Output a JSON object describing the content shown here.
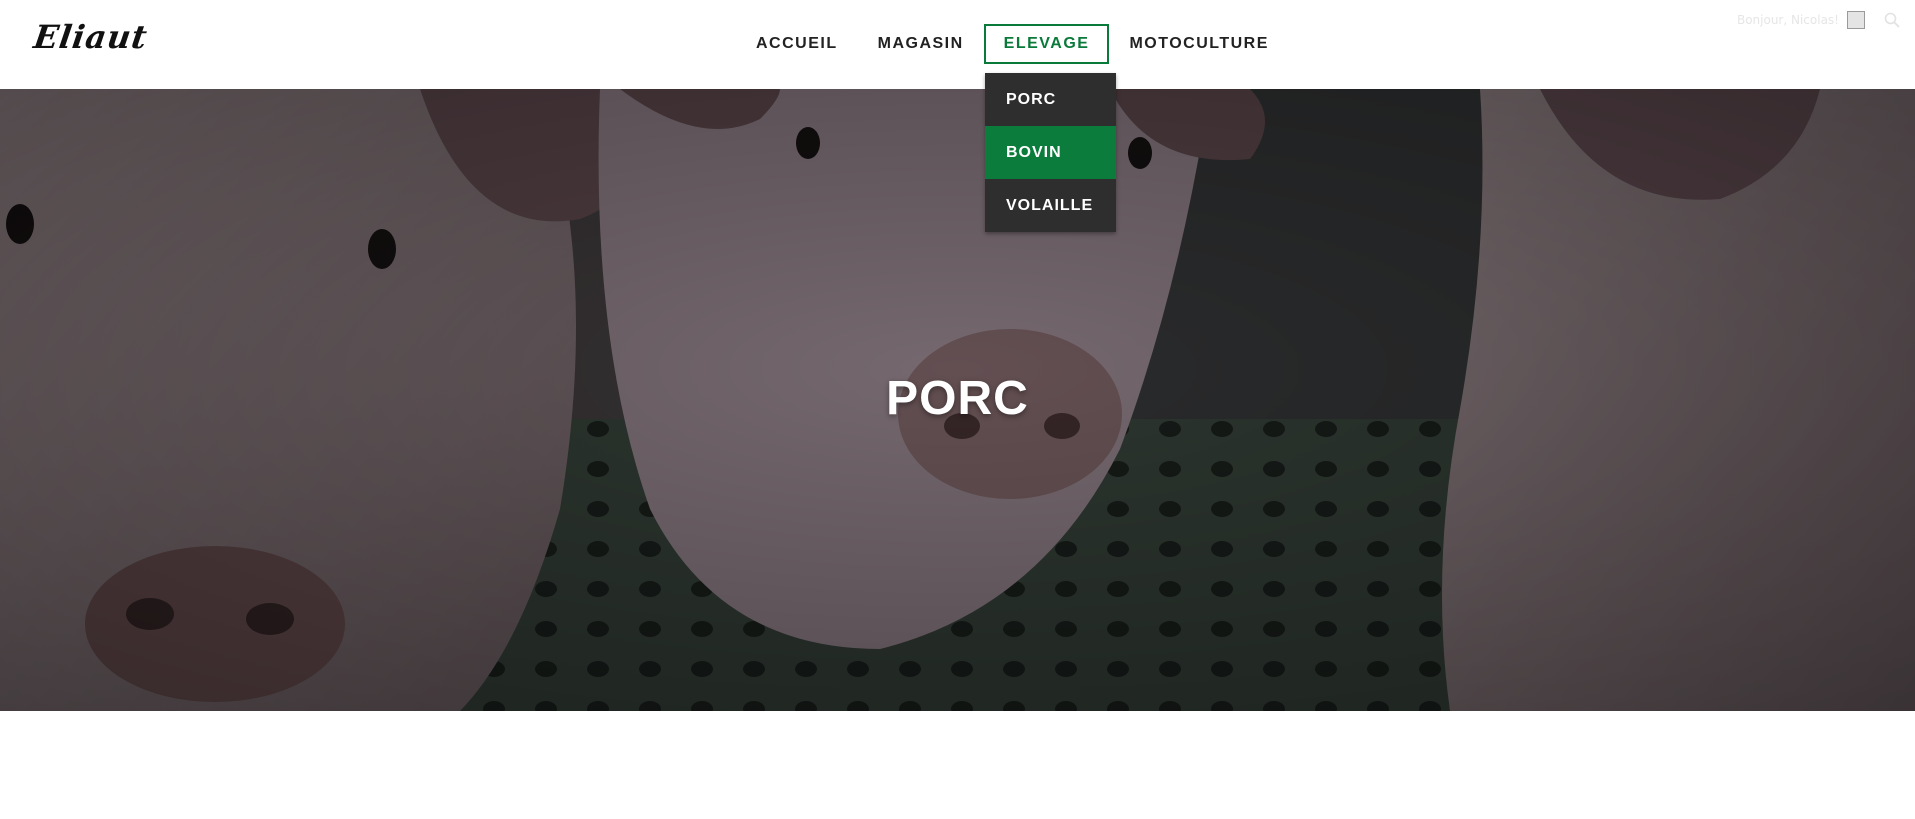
{
  "brand": {
    "logo_text": "Eliaut"
  },
  "nav": {
    "items": [
      {
        "label": "ACCUEIL"
      },
      {
        "label": "MAGASIN"
      },
      {
        "label": "ELEVAGE"
      },
      {
        "label": "MOTOCULTURE"
      }
    ],
    "active_label": "ELEVAGE"
  },
  "dropdown": {
    "items": [
      {
        "label": "PORC"
      },
      {
        "label": "BOVIN"
      },
      {
        "label": "VOLAILLE"
      }
    ],
    "highlighted_label": "BOVIN"
  },
  "user": {
    "greeting": "Bonjour, Nicolas!",
    "search_icon": "search-icon"
  },
  "hero": {
    "title": "PORC",
    "image": "pigs-photo"
  },
  "colors": {
    "accent_green": "#0b7c3c",
    "dropdown_bg": "#2e2e2e",
    "nav_text": "#222222"
  }
}
